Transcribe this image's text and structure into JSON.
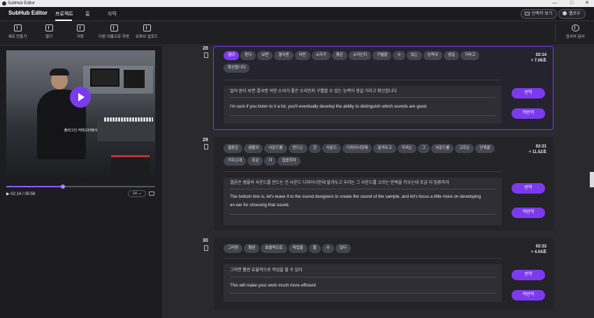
{
  "window": {
    "title": "SubHub Editor",
    "controls": [
      "—",
      "□",
      "✕"
    ]
  },
  "menubar": {
    "brand": "SubHub Editor",
    "items": [
      "프로젝트",
      "홈",
      "자막"
    ],
    "shortcut_label": "단축키 보기",
    "user_label": "멜로우"
  },
  "toolbar": {
    "items": [
      "새로 만들기",
      "열기",
      "저장",
      "다른 이름으로 저장",
      "유튜브 업로드"
    ],
    "search_label": "검사어 검사"
  },
  "player": {
    "subtitle_overlay": "플러그인 카테고리에서",
    "time": "02:14 / 05:58",
    "speed": "1X",
    "progress": 0.38
  },
  "accent": "#7c3aed",
  "entries": [
    {
      "number": "28",
      "selected": true,
      "words": [
        "얼어",
        "듣다",
        "보면",
        "결국엔",
        "어떤",
        "소리가",
        "좋은",
        "소리인지",
        "구별할",
        "수",
        "있는",
        "능력이",
        "생길",
        "거라고",
        "확신합니다"
      ],
      "selected_word": 0,
      "start": "02:14",
      "duration": "+ 7.06초",
      "korean": "얼어 듣다 보면 결국엔 어떤 소리가 좋은 소리인지 구별할 수 있는 능력이 생길 거라고 확신합니다",
      "english": "I'm sure if you listen to it a lot, you'll eventually develop the ability to distinguish which sounds are good.",
      "translate": "번역",
      "back_translate": "역번역"
    },
    {
      "number": "29",
      "selected": false,
      "words": [
        "결론은",
        "샘플의",
        "사운드를",
        "만드는",
        "건",
        "사운드",
        "디자이너한테",
        "맡겨두고",
        "우리는",
        "그",
        "사운드를",
        "고르는",
        "안목을",
        "키우는데",
        "조금",
        "더",
        "집중하자"
      ],
      "start": "02:21",
      "duration": "+ 11.52초",
      "korean": "결론은 샘플의 사운드를 만드는 건 사운드 디자이너한테 맡겨두고 우리는 그 사운드를 고르는 안목을 키우는데 조금 더 집중하자",
      "english_lines": [
        "The bottom line is, let's leave it to the sound designers to create the sound of the sample, and let's focus a little more on developing",
        "an ear for choosing that sound."
      ],
      "translate": "번역",
      "back_translate": "역번역"
    },
    {
      "number": "30",
      "selected": false,
      "words": [
        "그러면",
        "훨씬",
        "효율적으로",
        "작업을",
        "할",
        "수",
        "있다"
      ],
      "start": "02:33",
      "duration": "+ 4.04초",
      "korean": "그러면 훨씬 효율적으로 작업을 할 수 있다",
      "english": "This will make your work much more efficient",
      "translate": "번역",
      "back_translate": "역번역"
    }
  ]
}
